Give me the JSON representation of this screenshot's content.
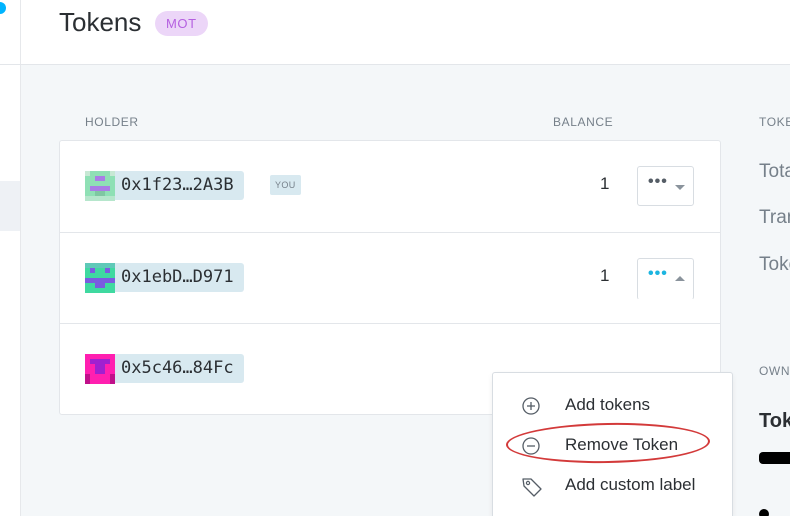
{
  "header": {
    "title": "Tokens",
    "token_badge": "MOT"
  },
  "table": {
    "columns": {
      "holder": "HOLDER",
      "balance": "BALANCE"
    },
    "rows": [
      {
        "address": "0x1f23…2A3B",
        "tag": "YOU",
        "balance": "1",
        "avatar_colors": [
          "#8fe0b5",
          "#a97de6"
        ]
      },
      {
        "address": "0x1ebD…D971",
        "tag": "",
        "balance": "1",
        "avatar_colors": [
          "#3fd9a0",
          "#7a5ce0"
        ]
      },
      {
        "address": "0x5c46…84Fc",
        "tag": "",
        "balance": "",
        "avatar_colors": [
          "#ff1fb0",
          "#a020d0"
        ]
      }
    ]
  },
  "dropdown": {
    "items": [
      {
        "label": "Add tokens",
        "icon": "plus-circle-icon"
      },
      {
        "label": "Remove Token",
        "icon": "minus-circle-icon",
        "highlighted": true
      },
      {
        "label": "Add custom label",
        "icon": "tag-icon"
      }
    ],
    "highlight_color": "#d33a3a"
  },
  "sidebar_right": {
    "heading": "TOKE",
    "labels": [
      "Tota",
      "Tran",
      "Toke"
    ],
    "section_heading": "OWN",
    "bold_label": "Tok"
  },
  "colors": {
    "accent": "#1cb5e0",
    "badge_bg": "#ecd6f8",
    "badge_text": "#b560e0",
    "address_bg": "#d8e9f0"
  }
}
